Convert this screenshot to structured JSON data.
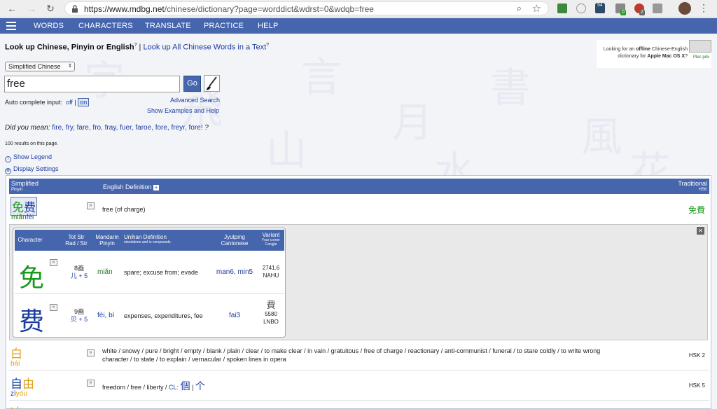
{
  "browser": {
    "url_prefix": "https://www.mdbg.net",
    "url_rest": "/chinese/dictionary?page=worddict&wdrst=0&wdqb=free",
    "ext_badges": [
      "54",
      "0",
      "2"
    ]
  },
  "menu": {
    "items": [
      "WORDS",
      "CHARACTERS",
      "TRANSLATE",
      "PRACTICE",
      "HELP"
    ]
  },
  "lookup": {
    "title": "Look up Chinese, Pinyin or English",
    "sep": " | ",
    "link": "Look up All Chinese Words in a Text",
    "sup": "?"
  },
  "promo": {
    "line1": "Looking for an ",
    "offline": "offline",
    "line1b": " Chinese-English",
    "line2": "dictionary for ",
    "mac": "Apple Mac OS X",
    "q": "?",
    "app_label": "Plec pdx"
  },
  "form": {
    "script_select": "Simplified Chinese",
    "query": "free",
    "go_label": "Go",
    "autocomplete_label": "Auto complete input:",
    "off_label": "off",
    "on_label": "on",
    "advanced_label": "Advanced Search",
    "examples_label": "Show Examples and Help"
  },
  "did_you_mean": {
    "prefix": "Did you mean: ",
    "suggestions": "fire, fry, fare, fro, fray, fuer, faroe, fore, freyr, fore!",
    "suffix": " ?"
  },
  "results_count": "100 results on this page.",
  "show_legend": "Show Legend",
  "display_settings": "Display Settings",
  "table": {
    "col_simplified": "Simplified",
    "col_pinyin": "Pinyin",
    "col_english": "English Definition",
    "col_traditional": "Traditional",
    "col_hsk": "HSK"
  },
  "entries": [
    {
      "chars": [
        "免",
        "费"
      ],
      "pinyin": [
        "miǎn",
        "fèi"
      ],
      "def": "free (of charge)",
      "traditional": "免費",
      "hsk": ""
    },
    {
      "chars": [
        "白"
      ],
      "pinyin": [
        "bái"
      ],
      "def_line1": "white / snowy / pure / bright / empty / blank / plain / clear / to make clear / in vain / gratuitous / free of charge / reactionary / anti-communist / funeral / to stare coldly / to write wrong",
      "def_line2": "character / to state / to explain / vernacular / spoken lines in opera",
      "hsk": "HSK 2"
    },
    {
      "chars": [
        "自",
        "由"
      ],
      "pinyin": [
        "zì",
        "yóu"
      ],
      "def": "freedom / free / liberty / ",
      "cl_label": "CL:",
      "cl_trad": "個",
      "cl_simp": "个",
      "hsk": "HSK 5"
    }
  ],
  "char_detail": {
    "headers": {
      "character": "Character",
      "totstr": "Tot Str",
      "radstr": "Rad / Str",
      "mandarin": "Mandarin",
      "pinyin": "Pinyin",
      "unihan": "Unihan Definition",
      "unihan_sub": "standalone and in compounds",
      "jyutping": "Jyutping",
      "cantonese": "Cantonese",
      "variant": "Variant",
      "fourcorner": "Four corner",
      "cangjie": "Cangjie"
    },
    "rows": [
      {
        "char": "免",
        "strokes": "8画",
        "radical": "儿 + 5",
        "pinyin": "miǎn",
        "definition": "spare; excuse from; evade",
        "jyutping": "man6, min5",
        "variant": "",
        "fourcorner": "2741.6",
        "cangjie": "NAHU"
      },
      {
        "char": "费",
        "strokes": "9画",
        "radical": "贝 + 5",
        "pinyin": "fèi, bì",
        "definition": "expenses, expenditures, fee",
        "jyutping": "fai3",
        "variant": "費",
        "fourcorner": "5580",
        "cangjie": "LNBO"
      }
    ]
  },
  "colors": {
    "accent": "#4565ad",
    "tone1": "#e0a020",
    "tone2": "#1a9a1a",
    "tone3": "#1a7a1a",
    "tone4": "#1a3ca0",
    "tone5": "#555555"
  }
}
